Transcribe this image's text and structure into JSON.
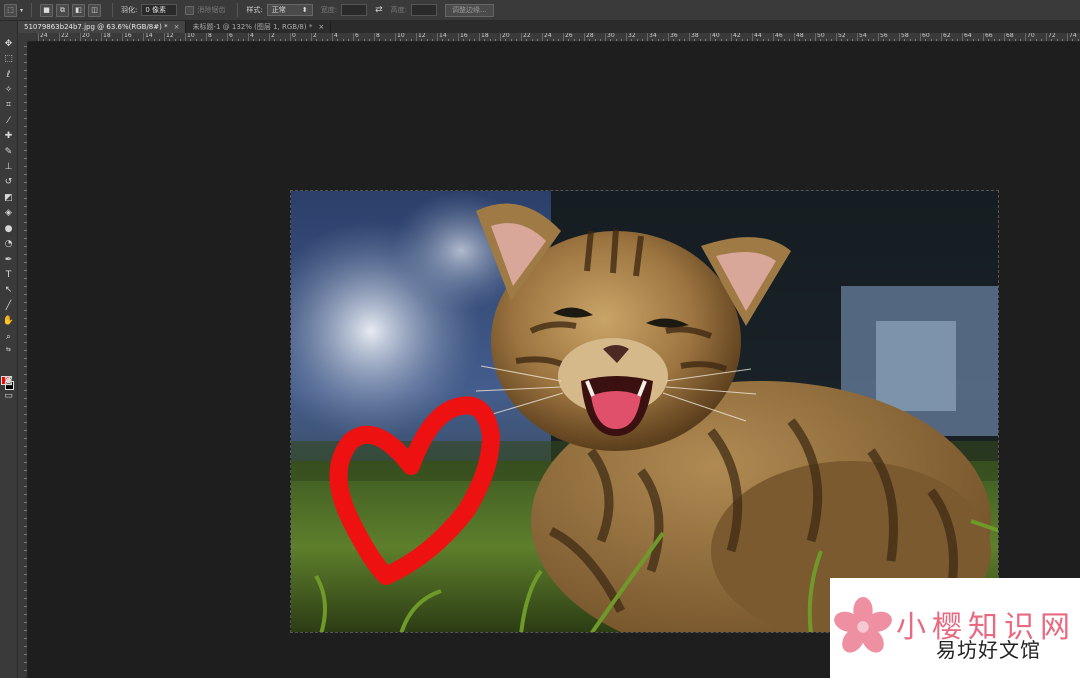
{
  "options_bar": {
    "feather_label": "羽化:",
    "feather_value": "0 像素",
    "antialias_label": "消除锯齿",
    "style_label": "样式:",
    "style_value": "正常",
    "width_label": "宽度:",
    "height_label": "高度:",
    "refine_edge_label": "调整边缘..."
  },
  "tabs": [
    {
      "label": "51079863b24b7.jpg @ 63.6%(RGB/8#) *",
      "close": "×",
      "active": true
    },
    {
      "label": "未标题-1 @ 132% (图层 1, RGB/8) *",
      "close": "×",
      "active": false
    }
  ],
  "ruler": {
    "h_labels": [
      "24",
      "22",
      "20",
      "18",
      "16",
      "14",
      "12",
      "10",
      "8",
      "6",
      "4",
      "2",
      "0",
      "2",
      "4",
      "6",
      "8",
      "10",
      "12",
      "14",
      "16",
      "18",
      "20",
      "22",
      "24",
      "26",
      "28",
      "30",
      "32",
      "34",
      "36",
      "38",
      "40",
      "42",
      "44",
      "46",
      "48",
      "50",
      "52",
      "54",
      "56",
      "58",
      "60",
      "62",
      "64",
      "66",
      "68",
      "70",
      "72",
      "74"
    ]
  },
  "toolbox": {
    "foreground_color": "#ff0000",
    "background_color": "#000000"
  },
  "document": {
    "heart_color": "#ee1111"
  },
  "watermark": {
    "title": "小樱知识网",
    "subtitle": "易坊好文馆"
  }
}
